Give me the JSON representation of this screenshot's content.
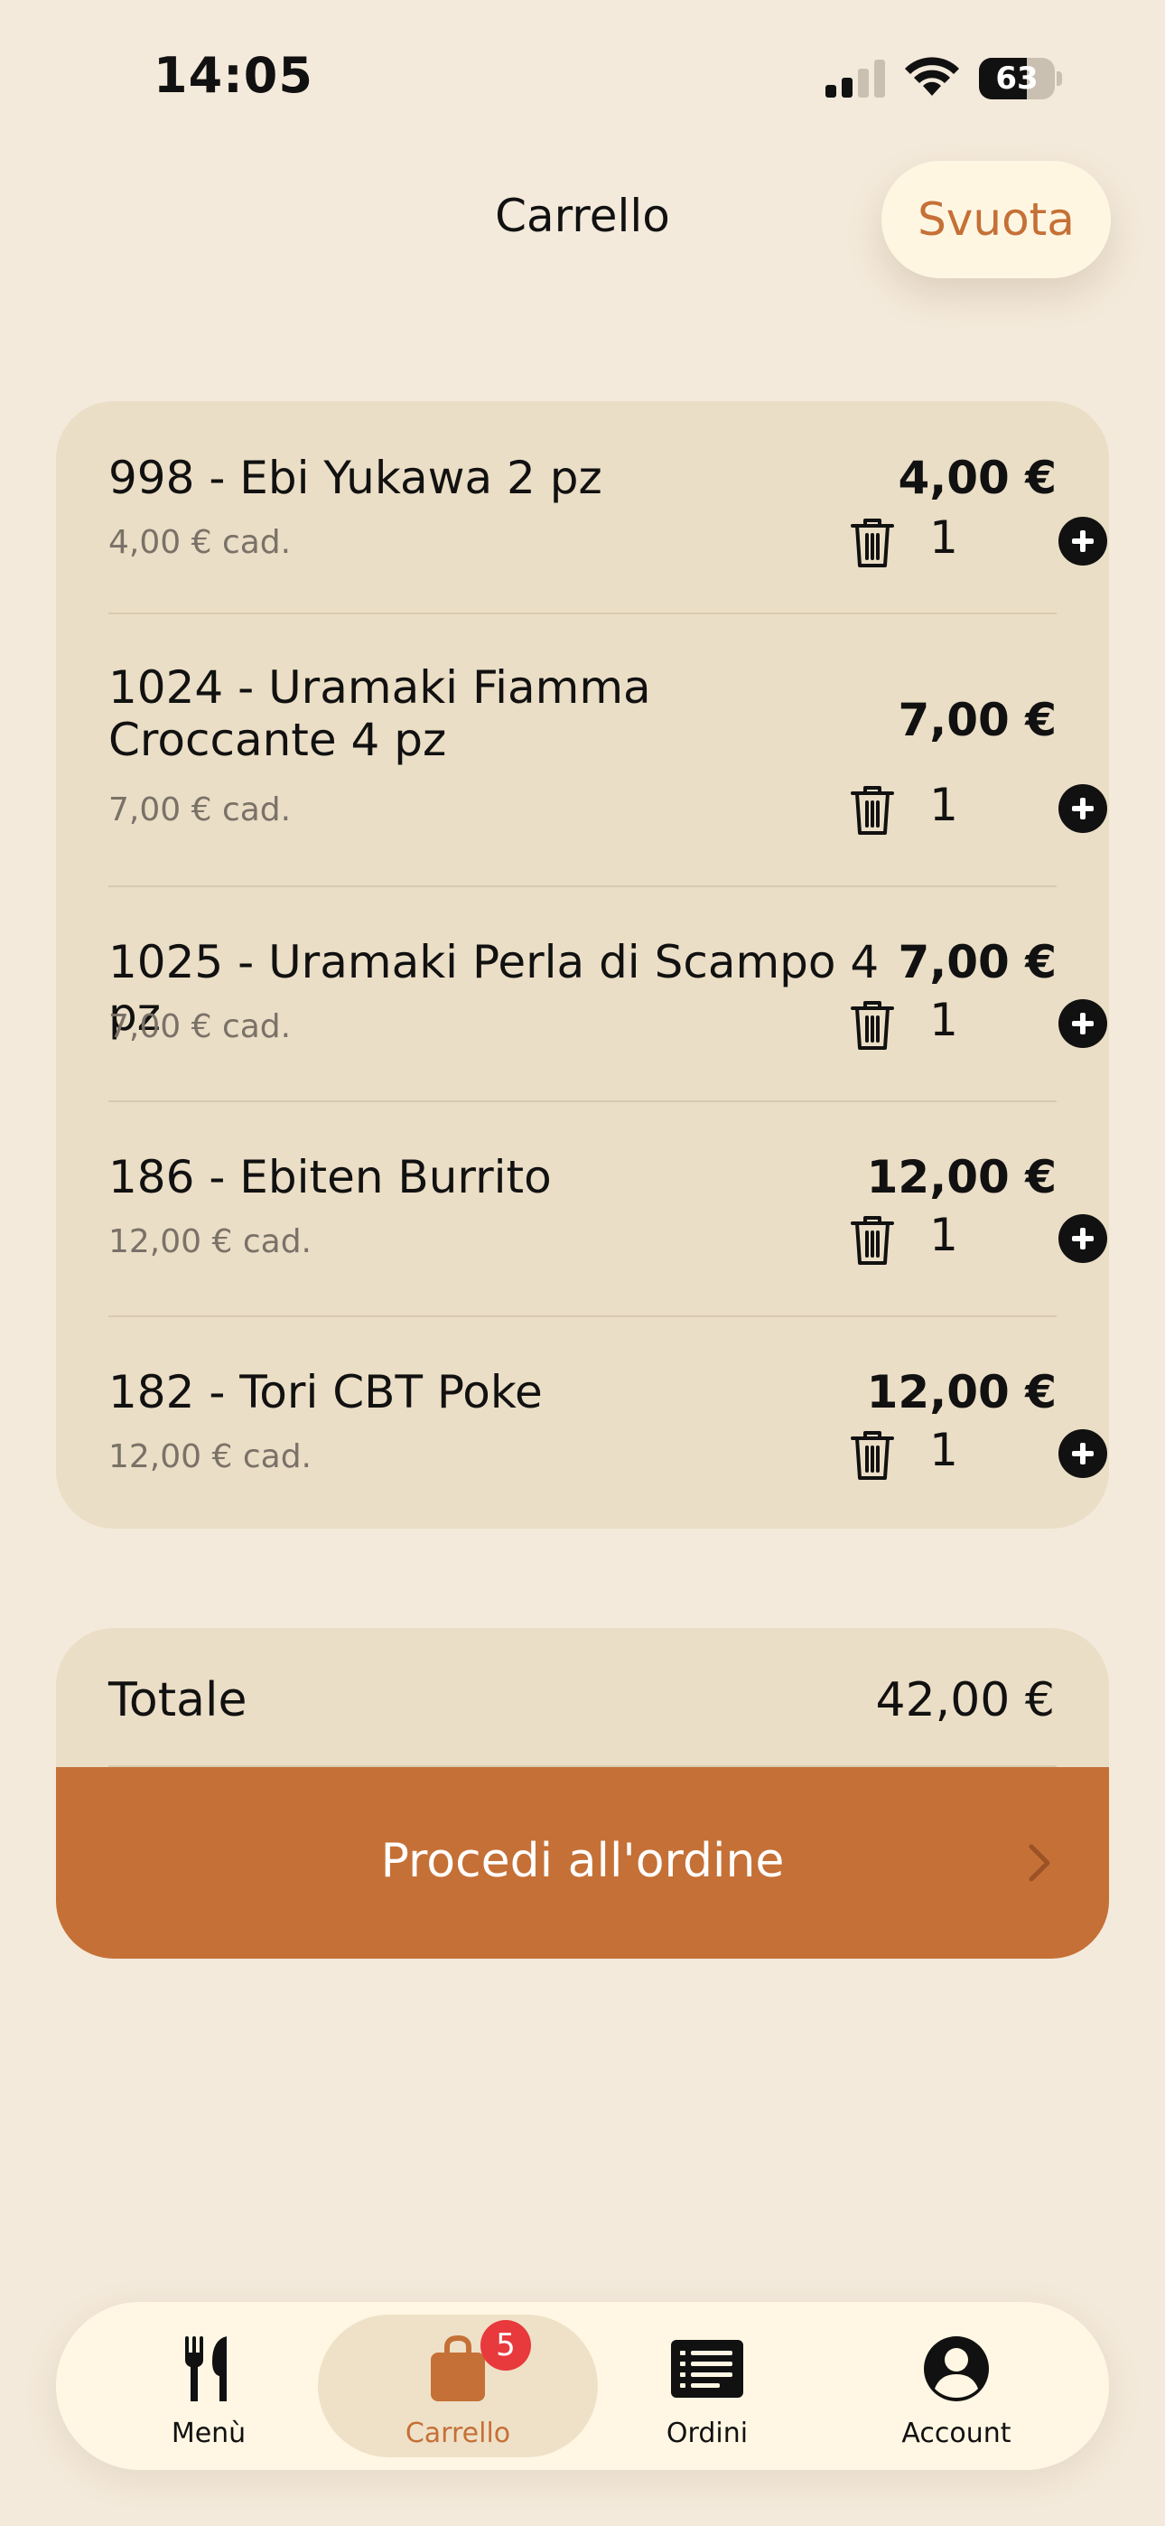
{
  "status_bar": {
    "time": "14:05",
    "battery": "63",
    "battery_level": 0.63
  },
  "header": {
    "title": "Carrello",
    "clear_label": "Svuota"
  },
  "cart": {
    "items": [
      {
        "name": "998 - Ebi Yukawa 2 pz",
        "unit_price": "4,00 € cad.",
        "price": "4,00 €",
        "qty": "1"
      },
      {
        "name": "1024 - Uramaki Fiamma Croccante 4 pz",
        "unit_price": "7,00 € cad.",
        "price": "7,00 €",
        "qty": "1"
      },
      {
        "name": "1025 - Uramaki Perla di Scampo 4 pz",
        "unit_price": "7,00 € cad.",
        "price": "7,00 €",
        "qty": "1"
      },
      {
        "name": "186 - Ebiten Burrito",
        "unit_price": "12,00 € cad.",
        "price": "12,00 €",
        "qty": "1"
      },
      {
        "name": "182 - Tori CBT Poke",
        "unit_price": "12,00 € cad.",
        "price": "12,00 €",
        "qty": "1"
      }
    ]
  },
  "summary": {
    "total_label": "Totale",
    "total_value": "42,00 €",
    "checkout_label": "Procedi all'ordine"
  },
  "tabbar": {
    "tabs": [
      {
        "label": "Menù",
        "icon": "fork-knife-icon"
      },
      {
        "label": "Carrello",
        "icon": "shopping-bag-icon",
        "badge": "5",
        "active": true
      },
      {
        "label": "Ordini",
        "icon": "list-icon"
      },
      {
        "label": "Account",
        "icon": "person-icon"
      }
    ]
  },
  "colors": {
    "accent": "#c57036",
    "background": "#f4eadb",
    "card": "#ebdec6",
    "badge": "#e8393d"
  }
}
